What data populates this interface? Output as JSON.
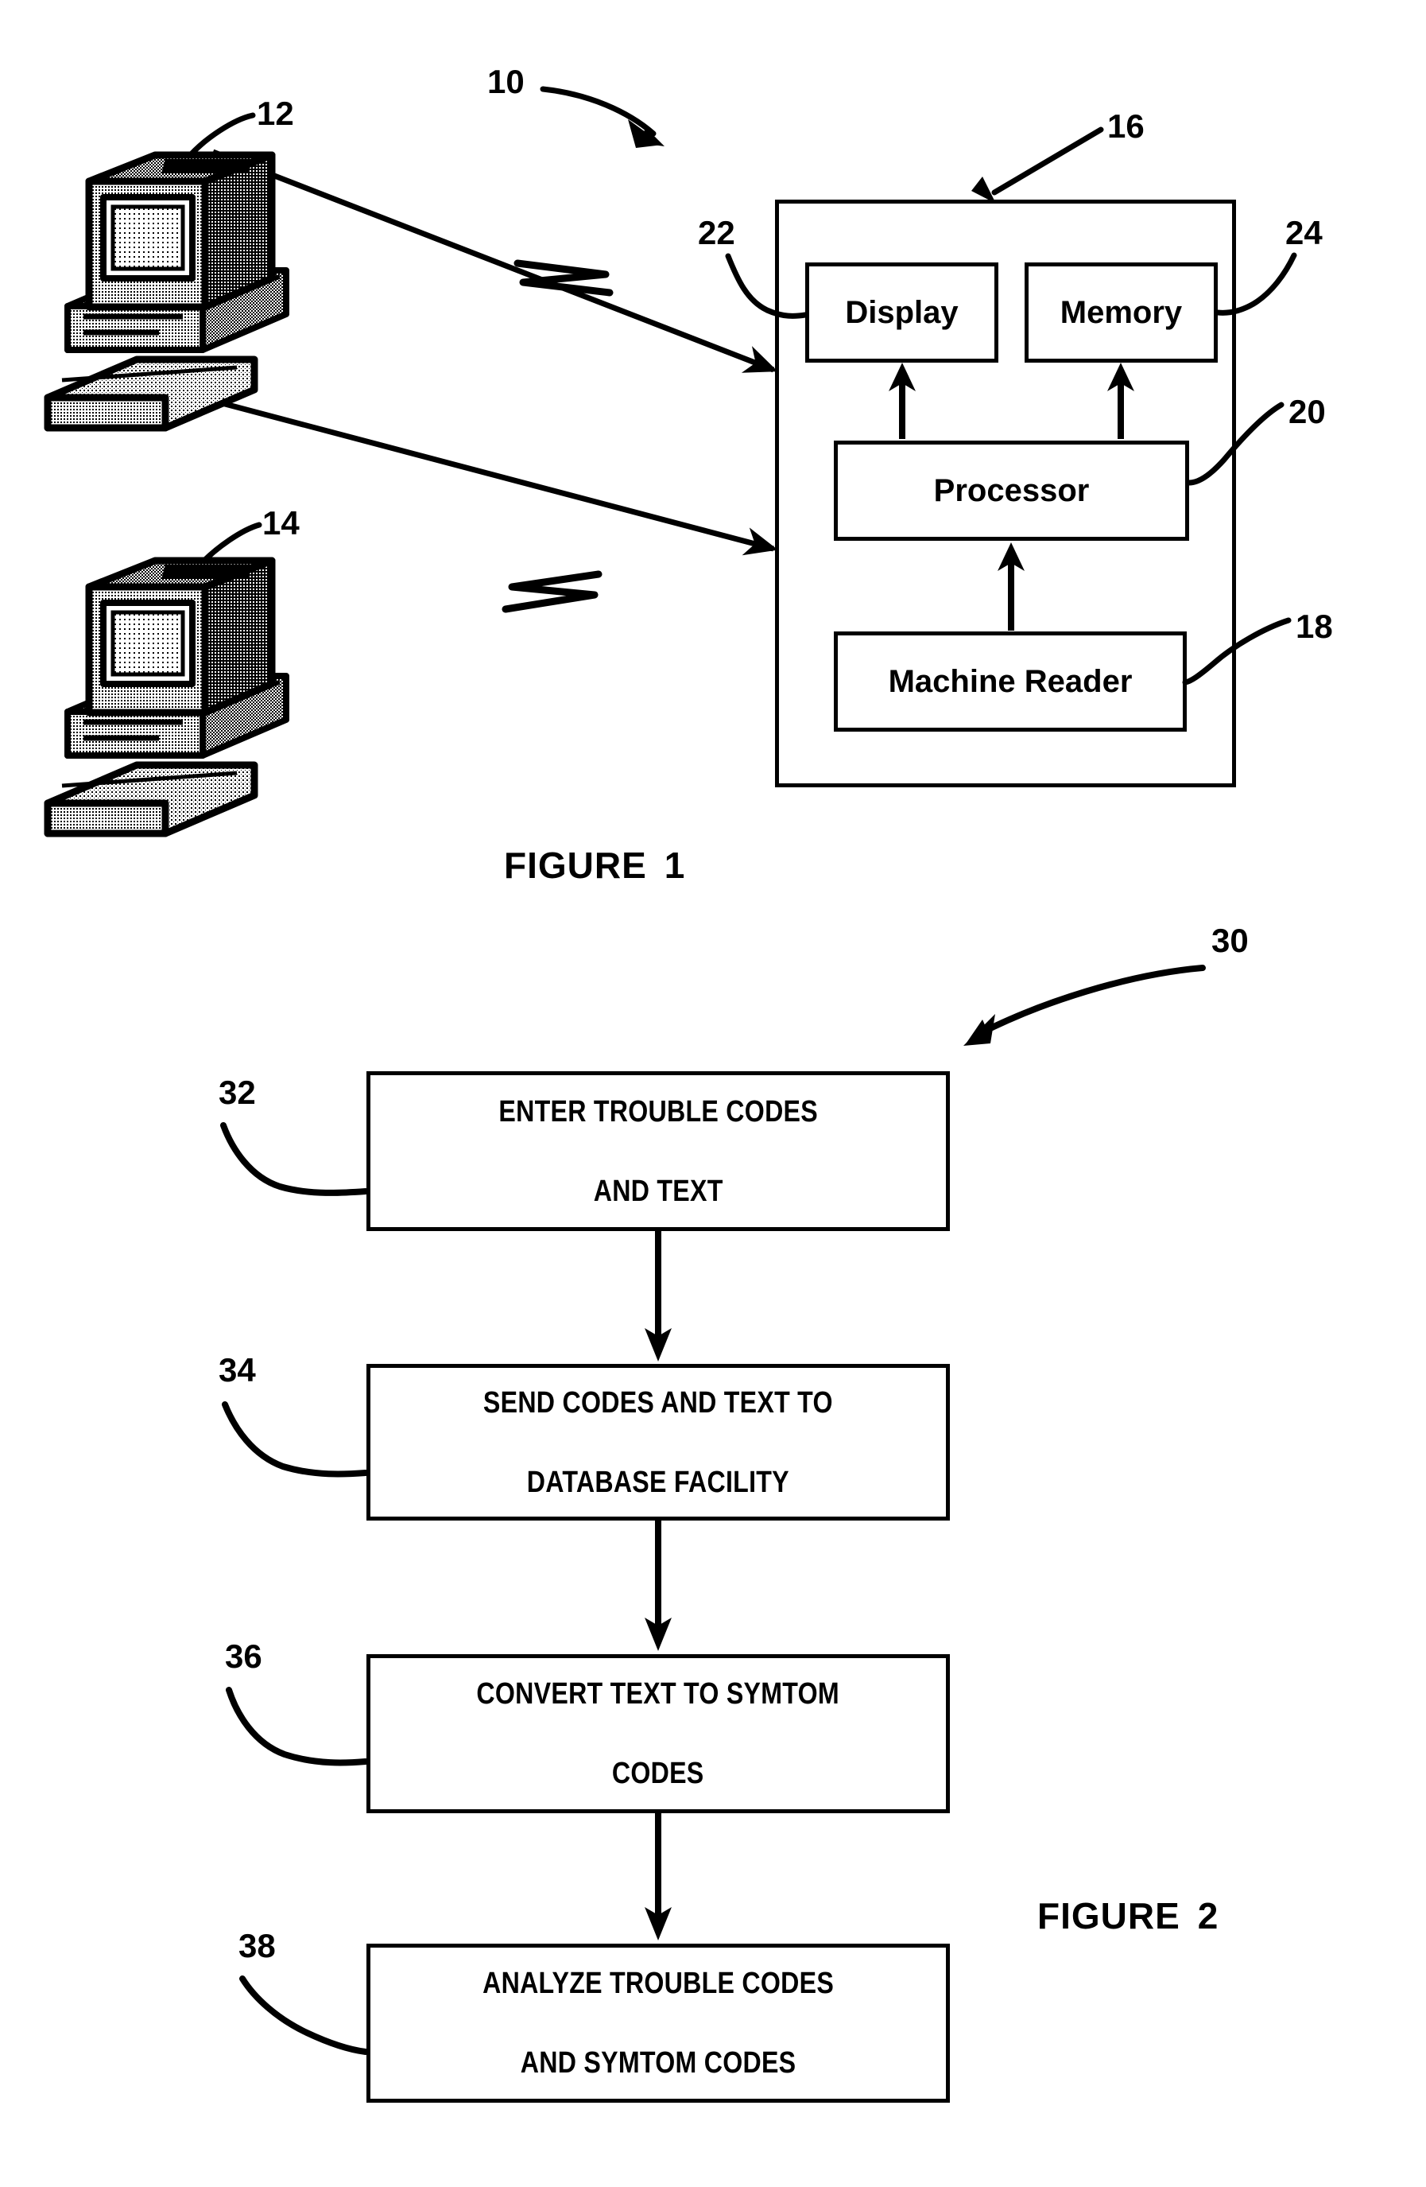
{
  "sheet": {
    "background": "#ffffff",
    "ink": "#000000"
  },
  "figure1": {
    "caption": "FIGURE",
    "caption_number": "1",
    "system_ref": "10",
    "enclosure_ref": "16",
    "terminals": [
      {
        "ref": "12",
        "icon": "desktop-computer-icon"
      },
      {
        "ref": "14",
        "icon": "desktop-computer-icon"
      }
    ],
    "blocks": [
      {
        "label": "Display",
        "ref": "22",
        "name": "display-block"
      },
      {
        "label": "Memory",
        "ref": "24",
        "name": "memory-block"
      },
      {
        "label": "Processor",
        "ref": "20",
        "name": "processor-block"
      },
      {
        "label": "Machine Reader",
        "ref": "18",
        "name": "machine-reader-block"
      }
    ],
    "links": [
      {
        "from": "12",
        "to": "16",
        "style": "broken-line-arrow"
      },
      {
        "from": "14",
        "to": "16",
        "style": "broken-line-arrow"
      },
      {
        "from": "20",
        "to": "22",
        "style": "arrow-up"
      },
      {
        "from": "20",
        "to": "24",
        "style": "arrow-up"
      },
      {
        "from": "18",
        "to": "20",
        "style": "arrow-up"
      }
    ]
  },
  "figure2": {
    "caption": "FIGURE",
    "caption_number": "2",
    "method_ref": "30",
    "steps": [
      {
        "ref": "32",
        "line1": "ENTER TROUBLE CODES",
        "line2": "AND TEXT"
      },
      {
        "ref": "34",
        "line1": "SEND CODES AND TEXT TO",
        "line2": "DATABASE FACILITY"
      },
      {
        "ref": "36",
        "line1": "CONVERT TEXT TO SYMTOM",
        "line2": "CODES"
      },
      {
        "ref": "38",
        "line1": "ANALYZE TROUBLE CODES",
        "line2": "AND SYMTOM CODES"
      }
    ]
  }
}
